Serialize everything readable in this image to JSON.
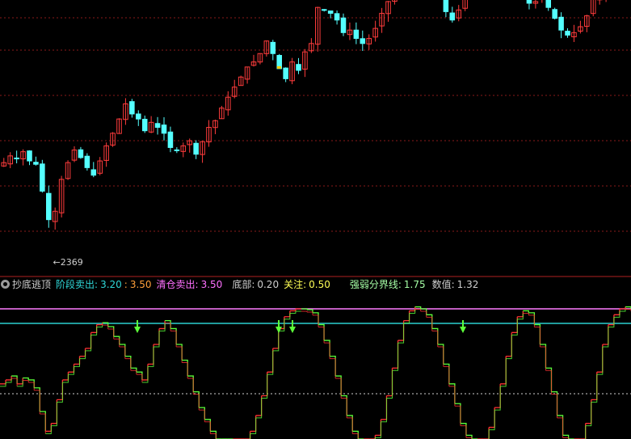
{
  "colors": {
    "background": "#000000",
    "up_candle": "#ff3c3c",
    "down_candle": "#54ffff",
    "grid": "#8a1a1a",
    "magenta_line": "#ff7cff",
    "cyan_line": "#2ad0d0",
    "red_step": "#ff3333",
    "green_step": "#5cff3a",
    "arrow": "#5cff3a",
    "marker": "#ffcc00",
    "indicator_name": "#cfcfcf",
    "stage_sell": "#2fd6d6",
    "stage_sell_val2": "#ff9f3a",
    "clear_sell": "#ff70ff",
    "bottom": "#cfcfcf",
    "watch": "#ffff55",
    "strength": "#a6ffa6",
    "value": "#cfcfcf"
  },
  "legend": {
    "icon": "gear-icon",
    "indicator_name": "抄底逃顶",
    "stage_sell_label": "阶段卖出:",
    "stage_sell_value1": "3.20",
    "stage_sell_sep": ":",
    "stage_sell_value2": "3.50",
    "clear_sell_label": "清仓卖出:",
    "clear_sell_value": "3.50",
    "bottom_label": "底部:",
    "bottom_value": "0.20",
    "watch_label": "关注:",
    "watch_value": "0.50",
    "strength_label": "强弱分界线:",
    "strength_value": "1.75",
    "value_label": "数值:",
    "value_value": "1.32"
  },
  "chart_data": [
    {
      "type": "candlestick",
      "ylim": [
        2340,
        2660
      ],
      "annotation": {
        "text": "2369",
        "arrow": "←",
        "at_index": 7
      },
      "closes": [
        2470,
        2478,
        2475,
        2483,
        2472,
        2468,
        2436,
        2402,
        2412,
        2450,
        2470,
        2485,
        2476,
        2464,
        2455,
        2472,
        2490,
        2505,
        2522,
        2540,
        2528,
        2522,
        2508,
        2518,
        2512,
        2505,
        2488,
        2485,
        2490,
        2496,
        2480,
        2495,
        2512,
        2520,
        2535,
        2548,
        2560,
        2572,
        2584,
        2590,
        2600,
        2615,
        2600,
        2582,
        2570,
        2590,
        2580,
        2602,
        2612,
        2655,
        2652,
        2648,
        2640,
        2625,
        2628,
        2618,
        2612,
        2618,
        2630,
        2648,
        2662,
        2672,
        2676,
        2692,
        2698,
        2690,
        2684,
        2680,
        2668,
        2650,
        2640,
        2652,
        2672,
        2690,
        2700,
        2715,
        2706,
        2690,
        2700,
        2695,
        2688,
        2672,
        2660,
        2662,
        2668,
        2655,
        2642,
        2628,
        2622,
        2625,
        2632,
        2645,
        2665,
        2672,
        2685,
        2698,
        2700,
        2705
      ],
      "ma_like_step": true
    },
    {
      "type": "step-line",
      "ylim": [
        0,
        3.5
      ],
      "levels": [
        {
          "name": "清仓卖出",
          "value": 3.5
        },
        {
          "name": "阶段卖出",
          "value": 3.2
        },
        {
          "name": "关注",
          "value": 0.5
        }
      ],
      "signal_arrows_at": [
        62,
        80,
        110,
        149
      ],
      "values": [
        1.6,
        1.7,
        1.8,
        1.6,
        1.75,
        1.7,
        1.5,
        0.9,
        0.4,
        0.6,
        1.2,
        1.7,
        1.9,
        2.1,
        2.3,
        2.5,
        2.9,
        3.1,
        3.15,
        3.05,
        2.8,
        2.6,
        2.3,
        2.0,
        1.9,
        1.7,
        2.1,
        2.6,
        3.0,
        3.2,
        3.0,
        2.6,
        2.2,
        1.8,
        1.4,
        1.0,
        0.7,
        0.4,
        0.2,
        0.1,
        0.05,
        0.02,
        0.05,
        0.15,
        0.4,
        0.8,
        1.3,
        1.9,
        2.5,
        3.0,
        3.3,
        3.45,
        3.5,
        3.5,
        3.48,
        3.4,
        3.1,
        2.7,
        2.3,
        1.8,
        1.3,
        0.8,
        0.4,
        0.15,
        0.05,
        0.1,
        0.3,
        0.7,
        1.3,
        2.0,
        2.7,
        3.2,
        3.45,
        3.55,
        3.5,
        3.35,
        3.0,
        2.6,
        2.1,
        1.6,
        1.1,
        0.6,
        0.3,
        0.15,
        0.1,
        0.2,
        0.5,
        1.0,
        1.6,
        2.3,
        2.9,
        3.3,
        3.45,
        3.4,
        3.1,
        2.6,
        2.0,
        1.4,
        0.8,
        0.3,
        0.08,
        0.05,
        0.2,
        0.6,
        1.2,
        1.9,
        2.6,
        3.1,
        3.35,
        3.5,
        3.55,
        3.5
      ]
    }
  ]
}
